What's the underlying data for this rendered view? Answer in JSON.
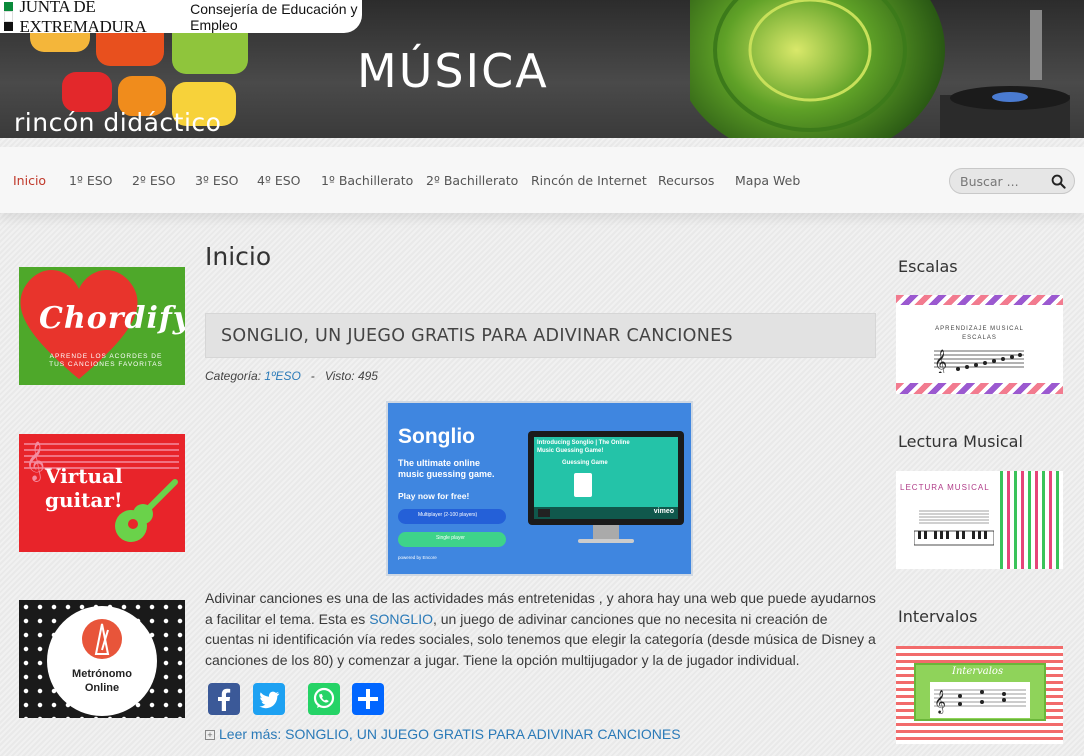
{
  "header": {
    "gov_name": "JUNTA DE EXTREMADURA",
    "department": "Consejería de Educación y Empleo",
    "site_title": "MÚSICA",
    "site_subtitle": "rincón didáctico"
  },
  "nav": {
    "items": [
      {
        "label": "Inicio",
        "active": true
      },
      {
        "label": "1º ESO"
      },
      {
        "label": "2º ESO"
      },
      {
        "label": "3º ESO"
      },
      {
        "label": "4º ESO"
      },
      {
        "label": "1º Bachillerato"
      },
      {
        "label": "2º Bachillerato"
      },
      {
        "label": "Rincón de Internet"
      },
      {
        "label": "Recursos"
      },
      {
        "label": "Mapa Web"
      }
    ],
    "search_placeholder": "Buscar ..."
  },
  "left_sidebar": {
    "chordify": {
      "title": "Chordify",
      "tagline": "APRENDE LOS ACORDES DE TUS CANCIONES FAVORITAS"
    },
    "guitar": {
      "title_line1": "Virtual",
      "title_line2": "guitar!"
    },
    "metronome": {
      "title_line1": "Metrónomo",
      "title_line2": "Online"
    }
  },
  "main": {
    "page_title": "Inicio",
    "article": {
      "title": "SONGLIO, UN JUEGO GRATIS PARA ADIVINAR CANCIONES",
      "category_label": "Categoría:",
      "category_value": "1ºESO",
      "views_label": "Visto: 495",
      "hero": {
        "brand": "Songlio",
        "tagline1": "The ultimate online",
        "tagline2": "music guessing game.",
        "cta": "Play now for free!",
        "btn_multi": "Multiplayer (2-100 players)",
        "btn_single": "Single player",
        "powered": "powered by Encore",
        "video_title1": "Introducing Songlio | The Online",
        "video_title2": "Music Guessing Game!",
        "video_sub": "Guessing Game",
        "vimeo": "vimeo"
      },
      "body_before": "Adivinar canciones es una de las actividades más entretenidas , y ahora hay una web que puede ayudarnos a facilitar el tema. Esta es ",
      "body_link": "SONGLIO",
      "body_after": ", un juego de adivinar canciones que no necesita ni creación de cuentas ni identificación vía redes sociales, solo tenemos que elegir la categoría (desde música de Disney a canciones de los 80) y comenzar a jugar. Tiene la opción multijugador y la de jugador individual.",
      "read_more": "Leer más: SONGLIO, UN JUEGO GRATIS PARA ADIVINAR CANCIONES"
    },
    "share": [
      "facebook-icon",
      "twitter-icon",
      "whatsapp-icon",
      "share-icon"
    ]
  },
  "right_sidebar": {
    "escalas": {
      "heading": "Escalas",
      "img_line1": "APRENDIZAJE MUSICAL",
      "img_line2": "ESCALAS"
    },
    "lectura": {
      "heading": "Lectura Musical",
      "img_text": "LECTURA MUSICAL"
    },
    "intervalos": {
      "heading": "Intervalos",
      "img_text": "Intervalos"
    }
  },
  "colors": {
    "accent": "#c0392b",
    "link": "#2a7ab8",
    "facebook": "#3b5998",
    "twitter": "#1da1f2",
    "whatsapp": "#25d366",
    "share": "#0166ff"
  }
}
